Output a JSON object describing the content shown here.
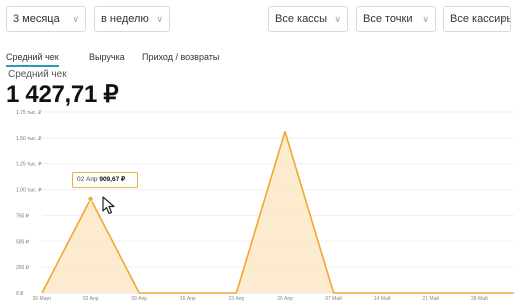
{
  "filters": {
    "period": "3 месяца",
    "granularity": "в неделю",
    "kassy": "Все кассы",
    "points": "Все точки",
    "cashiers": "Все кассиры"
  },
  "tabs": [
    {
      "label": "Средний чек",
      "active": true
    },
    {
      "label": "Выручка",
      "active": false
    },
    {
      "label": "Приход / возвраты",
      "active": false
    }
  ],
  "metric": {
    "label": "Средний чек",
    "value": "1 427,71 ₽"
  },
  "tooltip": {
    "date": "02 Апр",
    "value": "909,67 ₽"
  },
  "colors": {
    "accent": "#2a9bb0",
    "line": "#f0a830",
    "fill": "#fde8c8"
  },
  "chart_data": {
    "type": "area",
    "categories": [
      "26 Март",
      "02 Апр",
      "09 Апр",
      "16 Апр",
      "23 Апр",
      "30 Апр",
      "07 Май",
      "14 Май",
      "21 Май",
      "28 Май",
      "04 Июн"
    ],
    "values": [
      0,
      909.67,
      0,
      0,
      0,
      1560,
      0,
      0,
      0,
      0,
      0
    ],
    "y_ticks": [
      "0 ₽",
      "250 ₽",
      "500 ₽",
      "750 ₽",
      "1.00 тыс. ₽",
      "1.25 тыс. ₽",
      "1.50 тыс. ₽",
      "1.75 тыс. ₽"
    ],
    "ylim": [
      0,
      1750
    ],
    "grid": true
  }
}
